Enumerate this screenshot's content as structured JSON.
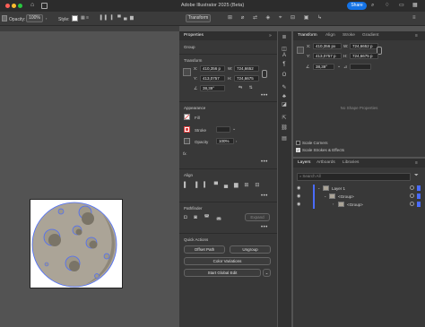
{
  "titlebar": {
    "title": "Adobe Illustrator 2025 (Beta)",
    "share_label": "Share"
  },
  "controlbar": {
    "opacity_label": "Opacity:",
    "opacity_value": "100%",
    "style_label": "Style:",
    "transform_label": "Transform"
  },
  "properties": {
    "tab_label": "Properties",
    "selection_label": "Group",
    "transform_title": "Transform",
    "x_label": "X:",
    "x_value": "410,356 p",
    "y_label": "Y:",
    "y_value": "413,0757",
    "w_label": "W:",
    "w_value": "724,6652",
    "h_label": "H:",
    "h_value": "724,6675",
    "angle_value": "38,39°",
    "appearance_title": "Appearance",
    "fill_label": "Fill",
    "stroke_label": "Stroke",
    "opacity_label": "Opacity",
    "opacity_value": "100%",
    "fx_label": "fx.",
    "align_title": "Align",
    "pathfinder_title": "Pathfinder",
    "expand_label": "Expand",
    "quick_actions_title": "Quick Actions",
    "offset_path_label": "Offset Path",
    "ungroup_label": "Ungroup",
    "color_variations_label": "Color Variations",
    "start_global_edit_label": "Start Global Edit"
  },
  "transform_panel": {
    "tabs": [
      {
        "label": "Transform"
      },
      {
        "label": "Align"
      },
      {
        "label": "Stroke"
      },
      {
        "label": "Gradient"
      }
    ],
    "x_label": "X:",
    "x_value": "410,356 px",
    "y_label": "Y:",
    "y_value": "413,0757 p",
    "w_label": "W:",
    "w_value": "724,6652 p",
    "h_label": "H:",
    "h_value": "724,6675 p",
    "angle_value": "38,39°",
    "empty_text": "No Shape Properties",
    "scale_corners_label": "Scale Corners",
    "scale_strokes_label": "Scale Strokes & Effects"
  },
  "layers_panel": {
    "tabs": [
      {
        "label": "Layers"
      },
      {
        "label": "Artboards"
      },
      {
        "label": "Libraries"
      }
    ],
    "search_placeholder": "Search All",
    "rows": [
      {
        "label": "Layer 1"
      },
      {
        "label": "<Group>"
      },
      {
        "label": "<Group>"
      }
    ]
  },
  "colors": {
    "accent": "#1473e6",
    "moon_fill": "#aba497",
    "moon_dark": "#8e8779",
    "selection": "#4a6cff",
    "stroke_swatch": "#e04040"
  },
  "icons": [
    "home-icon",
    "search-icon",
    "bell-icon",
    "grid-icon",
    "gear-icon",
    "layers-icon",
    "link-icon",
    "eye-icon",
    "lock-icon",
    "filter-icon",
    "chevron-down-icon",
    "more-icon"
  ]
}
